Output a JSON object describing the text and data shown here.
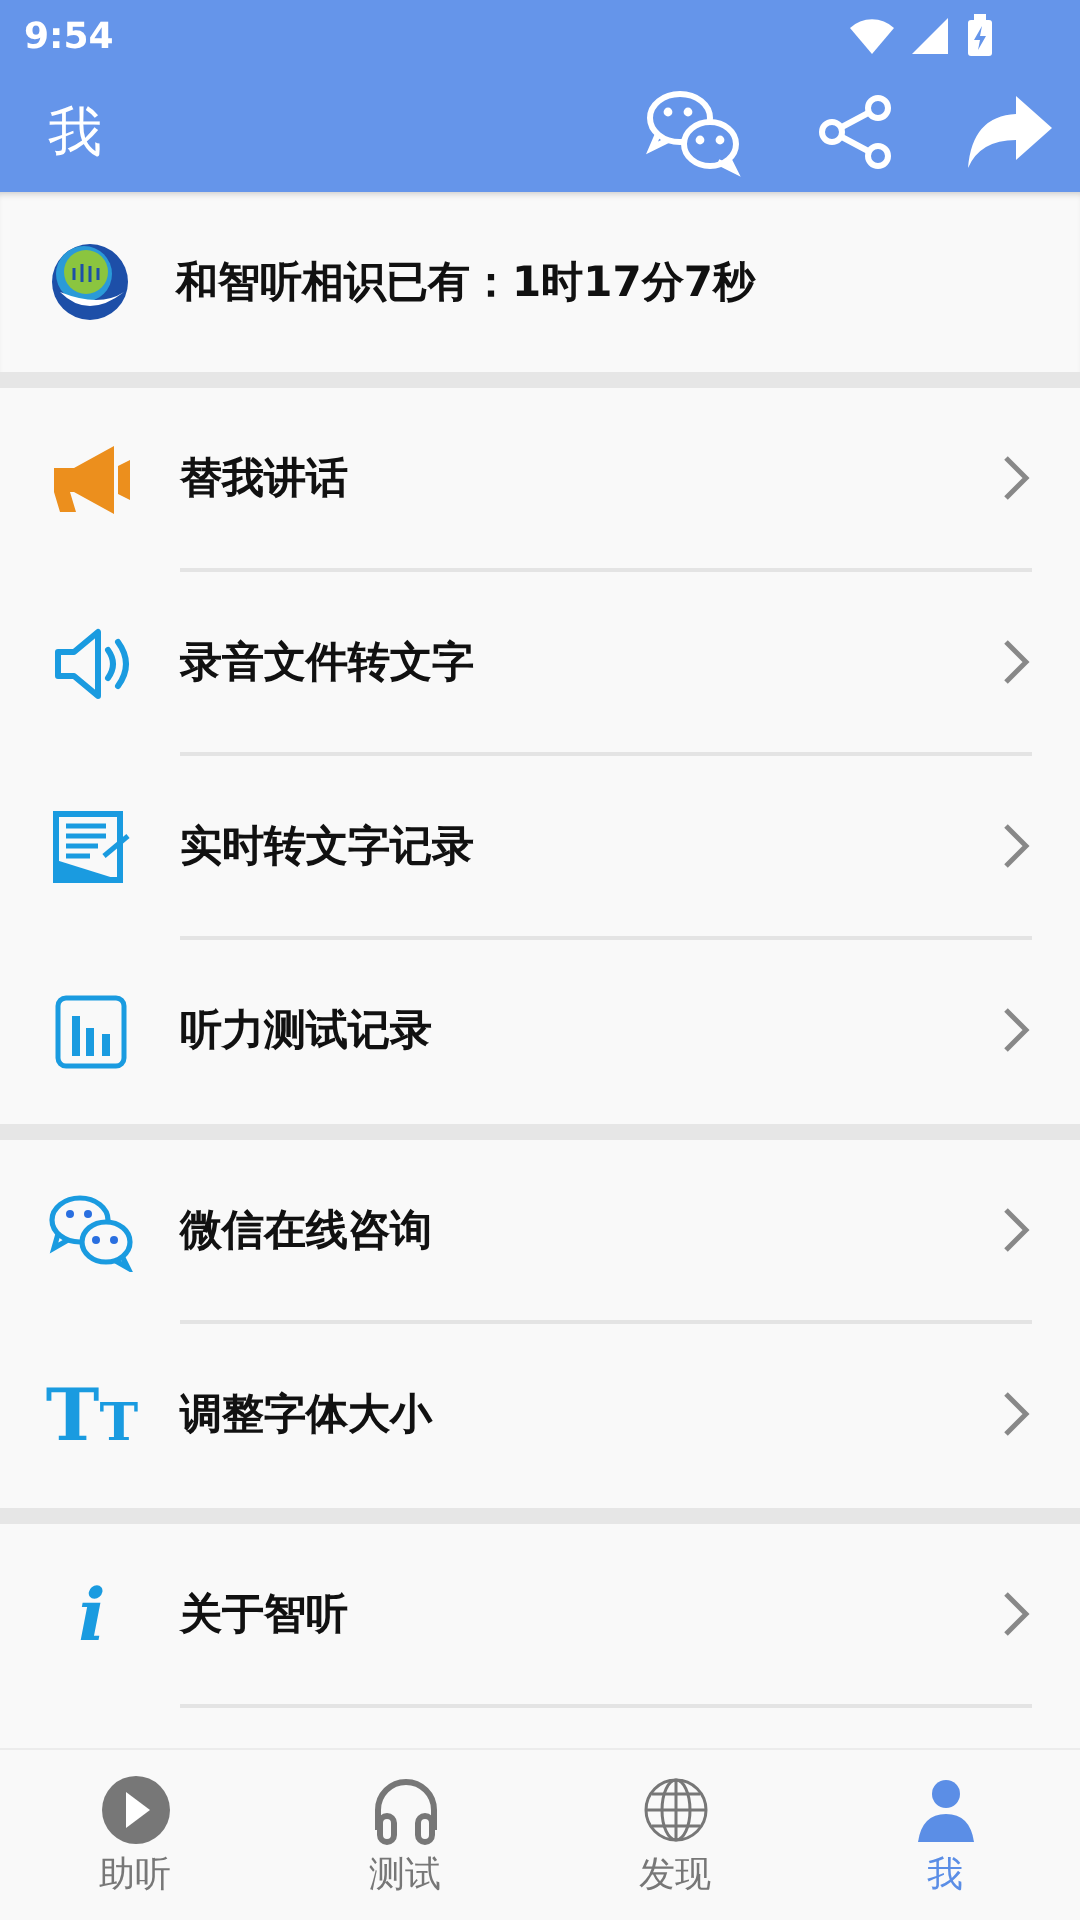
{
  "status_bar": {
    "time": "9:54"
  },
  "app_bar": {
    "title": "我"
  },
  "usage": {
    "text": "和智听相识已有：1时17分7秒"
  },
  "groups": [
    [
      {
        "kind": "megaphone",
        "label": "替我讲话"
      },
      {
        "kind": "speaker",
        "label": "录音文件转文字"
      },
      {
        "kind": "note",
        "label": "实时转文字记录"
      },
      {
        "kind": "chart",
        "label": "听力测试记录"
      }
    ],
    [
      {
        "kind": "chat",
        "label": "微信在线咨询"
      },
      {
        "kind": "glyph",
        "glyph": "TT",
        "label": "调整字体大小"
      }
    ],
    [
      {
        "kind": "glyph",
        "glyph": "i",
        "label": "关于智听"
      }
    ]
  ],
  "tabs": [
    {
      "kind": "play",
      "label": "助听",
      "selected": false
    },
    {
      "kind": "headphones",
      "label": "测试",
      "selected": false
    },
    {
      "kind": "globe",
      "label": "发现",
      "selected": false
    },
    {
      "kind": "person",
      "label": "我",
      "selected": true
    }
  ]
}
